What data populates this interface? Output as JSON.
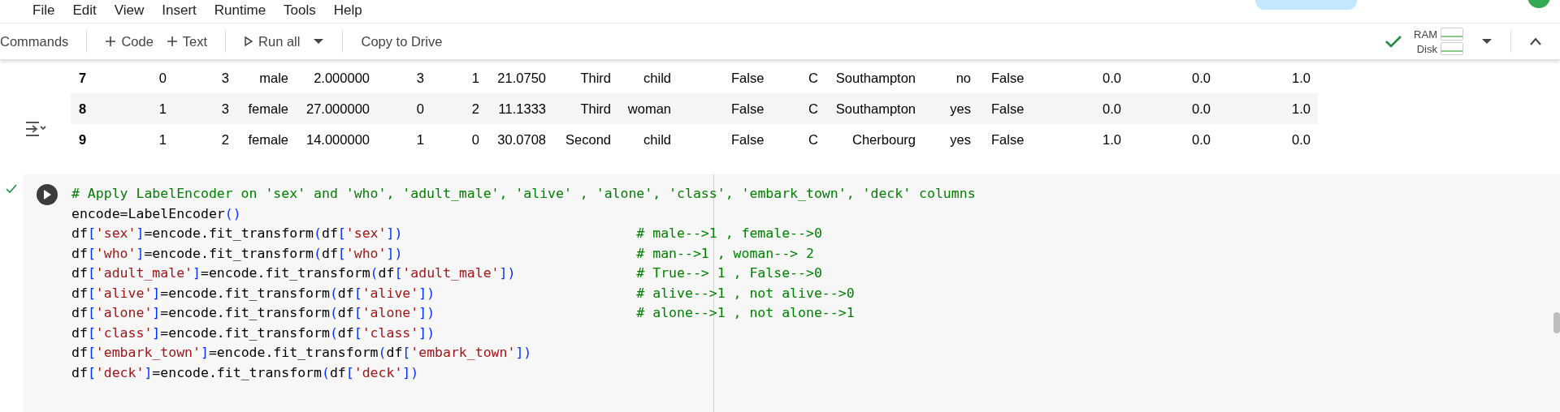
{
  "menu": [
    "File",
    "Edit",
    "View",
    "Insert",
    "Runtime",
    "Tools",
    "Help"
  ],
  "toolbar": {
    "commands": "Commands",
    "add_code": "Code",
    "add_text": "Text",
    "run_all": "Run all",
    "copy": "Copy to Drive",
    "ram": "RAM",
    "disk": "Disk",
    "connected": true
  },
  "table": {
    "rows": [
      [
        "7",
        "0",
        "3",
        "male",
        "2.000000",
        "3",
        "1",
        "21.0750",
        "Third",
        "child",
        "False",
        "C",
        "Southampton",
        "no",
        "False",
        "0.0",
        "0.0",
        "1.0"
      ],
      [
        "8",
        "1",
        "3",
        "female",
        "27.000000",
        "0",
        "2",
        "11.1333",
        "Third",
        "woman",
        "False",
        "C",
        "Southampton",
        "yes",
        "False",
        "0.0",
        "0.0",
        "1.0"
      ],
      [
        "9",
        "1",
        "2",
        "female",
        "14.000000",
        "1",
        "0",
        "30.0708",
        "Second",
        "child",
        "False",
        "C",
        "Cherbourg",
        "yes",
        "False",
        "1.0",
        "0.0",
        "0.0"
      ]
    ]
  },
  "cell": {
    "executed": true,
    "lines": [
      "# Apply LabelEncoder on 'sex' and 'who', 'adult_male', 'alive' , 'alone', 'class', 'embark_town', 'deck' columns",
      "encode=LabelEncoder()",
      {
        "code": "df['sex']=encode.fit_transform(df['sex'])",
        "comment": "# male-->1 , female-->0"
      },
      {
        "code": "df['who']=encode.fit_transform(df['who'])",
        "comment": "# man-->1 , woman--> 2"
      },
      {
        "code": "df['adult_male']=encode.fit_transform(df['adult_male'])",
        "comment": "# True--> 1 , False-->0"
      },
      {
        "code": "df['alive']=encode.fit_transform(df['alive'])",
        "comment": "# alive-->1 , not alive-->0"
      },
      {
        "code": "df['alone']=encode.fit_transform(df['alone'])",
        "comment": "# alone-->1 , not alone-->1"
      },
      "df['class']=encode.fit_transform(df['class'])",
      "df['embark_town']=encode.fit_transform(df['embark_town'])",
      "df['deck']=encode.fit_transform(df['deck'])"
    ]
  }
}
